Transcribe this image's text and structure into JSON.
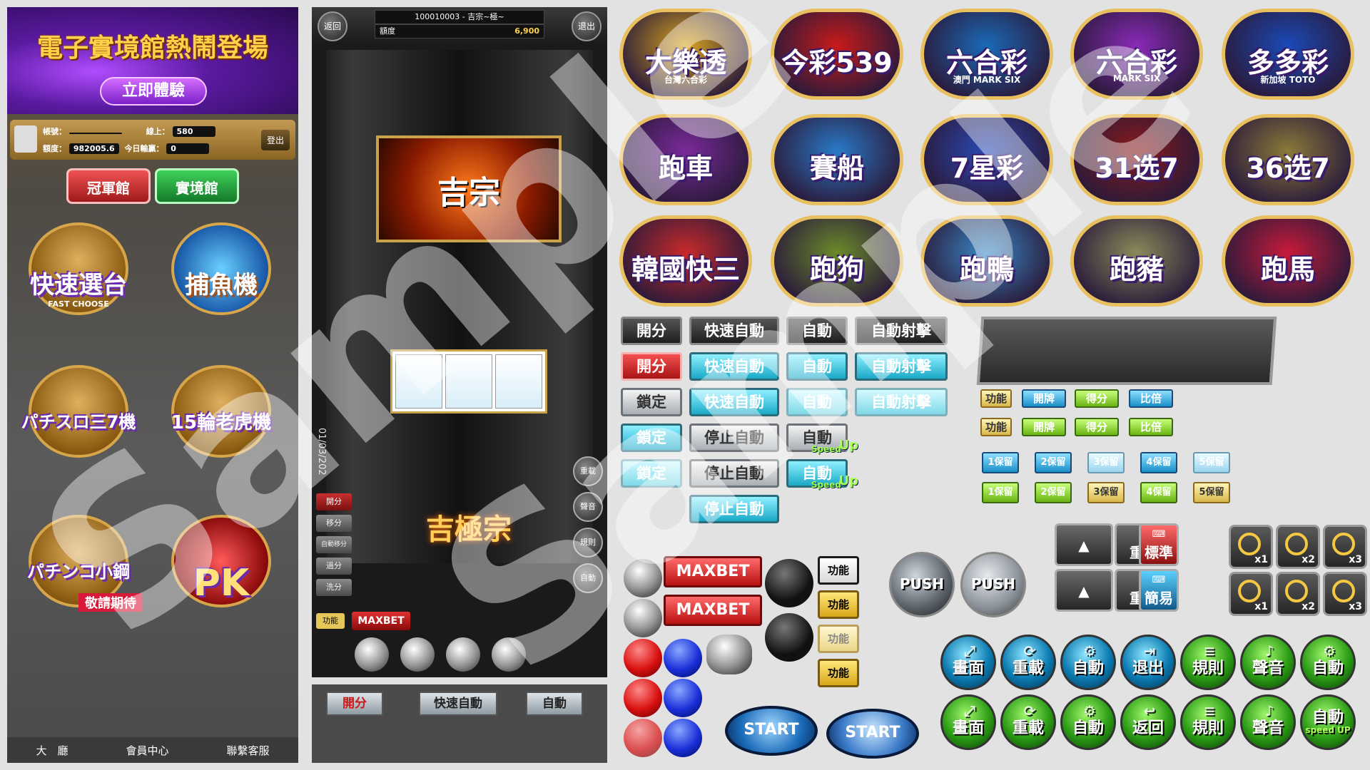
{
  "lobby": {
    "banner_title": "電子實境館熱鬧登場",
    "banner_button": "立即體驗",
    "account_label": "帳號：",
    "online_label": "線上：",
    "online_value": "580",
    "logout": "登出",
    "balance_label": "額度：",
    "balance_value": "982005.6",
    "today_label": "今日輸贏：",
    "today_value": "0",
    "tabs": [
      "冠軍館",
      "實境館"
    ],
    "games": [
      {
        "title": "快速選台",
        "sub": "FAST CHOOSE"
      },
      {
        "title": "捕魚機",
        "sub": ""
      },
      {
        "title": "パチスロ三7機",
        "sub": ""
      },
      {
        "title": "15輪老虎機",
        "sub": ""
      },
      {
        "title": "パチンコ小鋼",
        "sub": "敬請期待"
      },
      {
        "title": "PK",
        "sub": ""
      }
    ],
    "footer": [
      "大　廳",
      "會員中心",
      "聯繫客服"
    ]
  },
  "slot": {
    "back": "返回",
    "exit": "退出",
    "machine_id": "100010003 - 吉宗~極~",
    "credit_label": "額度",
    "credit_value": "6,900",
    "screen_logo": "吉宗",
    "lower_logo": "吉極宗",
    "date": "01/03/202",
    "side_buttons": [
      "開分",
      "移分",
      "自動移分",
      "過分",
      "洗分"
    ],
    "right_buttons": [
      "重載",
      "聲音",
      "規則",
      "自動"
    ],
    "func": "功能",
    "maxbet": "MAXBET",
    "bottom_buttons": [
      "開分",
      "快速自動",
      "自動"
    ]
  },
  "lottery_icons": [
    {
      "title": "大樂透",
      "sub": "台灣六合彩",
      "color": "#d9a520"
    },
    {
      "title": "今彩539",
      "sub": "",
      "color": "#c81a1a"
    },
    {
      "title": "六合彩",
      "sub": "澳門 MARK SIX",
      "color": "#1a6ab8"
    },
    {
      "title": "六合彩",
      "sub": "MARK SIX",
      "color": "#8a2ab8"
    },
    {
      "title": "多多彩",
      "sub": "新加坡 TOTO",
      "color": "#1a4ab8"
    },
    {
      "title": "跑車",
      "sub": "",
      "color": "#7a2a9a"
    },
    {
      "title": "賽船",
      "sub": "",
      "color": "#2a7ac8"
    },
    {
      "title": "7星彩",
      "sub": "",
      "color": "#2a4ab8"
    },
    {
      "title": "31选7",
      "sub": "",
      "color": "#8a1a1a"
    },
    {
      "title": "36选7",
      "sub": "",
      "color": "#8a7a3a"
    },
    {
      "title": "韓國快三",
      "sub": "",
      "color": "#c82a2a"
    },
    {
      "title": "跑狗",
      "sub": "",
      "color": "#6a8a2a"
    },
    {
      "title": "跑鴨",
      "sub": "",
      "color": "#3a8ac8"
    },
    {
      "title": "跑豬",
      "sub": "",
      "color": "#8a8a5a"
    },
    {
      "title": "跑馬",
      "sub": "",
      "color": "#c81a3a"
    }
  ],
  "action_buttons": {
    "open": "開分",
    "lock": "鎖定",
    "fast_auto": "快速自動",
    "stop_auto": "停止自動",
    "auto": "自動",
    "auto_shoot": "自動射擊",
    "speed": "Speed",
    "up": "Up"
  },
  "tray_buttons": [
    "功能",
    "開牌",
    "得分",
    "比倍"
  ],
  "hold_buttons": [
    "1保留",
    "2保留",
    "3保留",
    "4保留",
    "5保留"
  ],
  "controls": {
    "maxbet": "MAXBET",
    "func": "功能",
    "push": "PUSH",
    "start": "START",
    "reload": "重載",
    "standard": "標準",
    "simple": "簡易",
    "zoom": [
      "x1",
      "x2",
      "x3"
    ]
  },
  "circle_row1": [
    "畫面",
    "重載",
    "自動",
    "退出",
    "規則",
    "聲音",
    "自動"
  ],
  "circle_row2": [
    "畫面",
    "重載",
    "自動",
    "返回",
    "規則",
    "聲音",
    "自動"
  ],
  "circle_speed_up": "speed UP",
  "watermark": "Sample"
}
